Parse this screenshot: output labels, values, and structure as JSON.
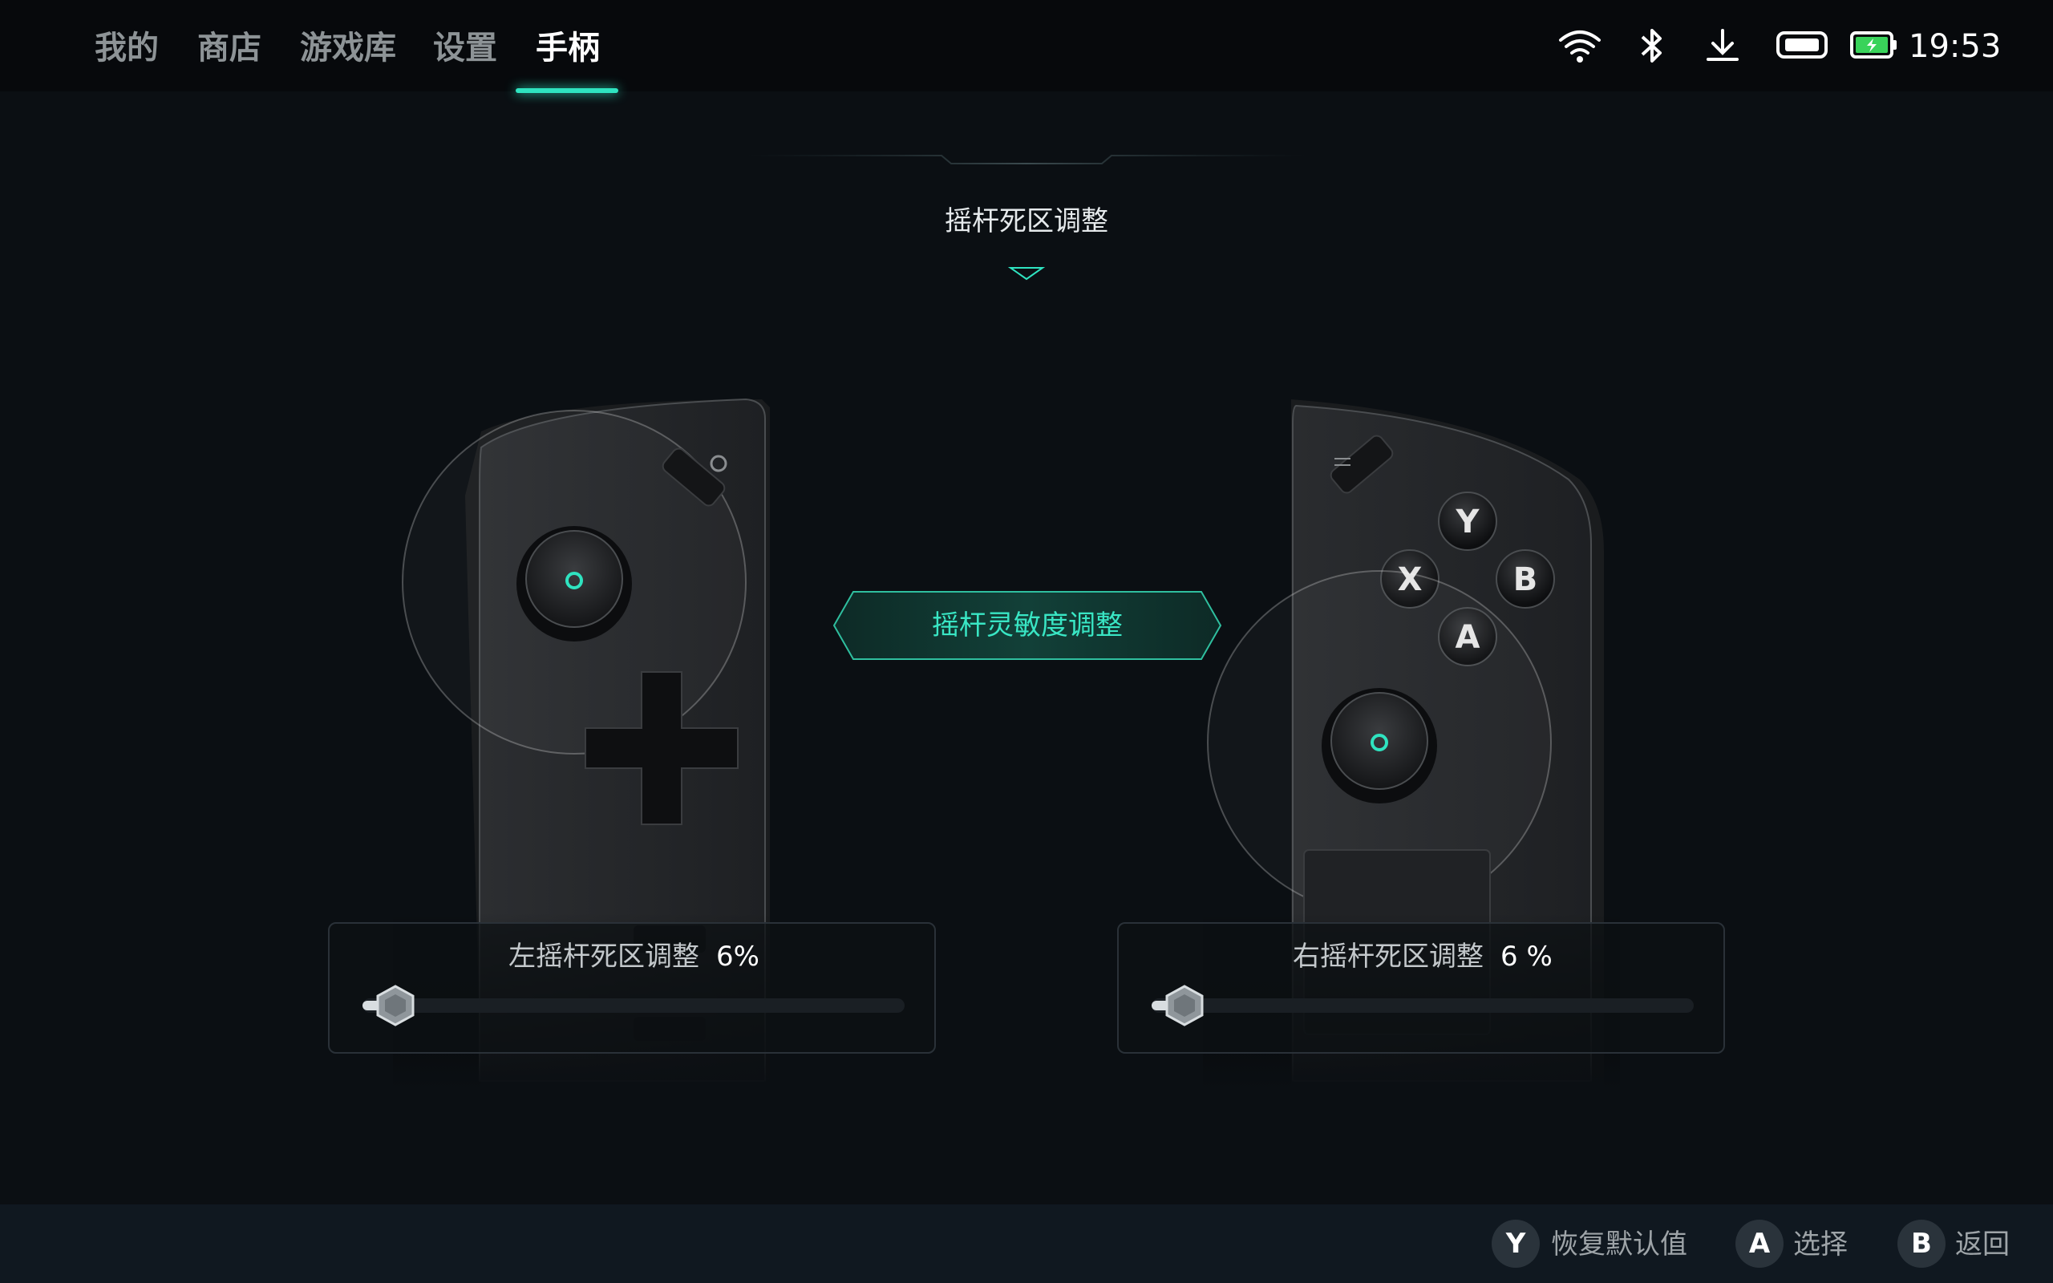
{
  "nav": {
    "tabs": [
      {
        "label": "我的"
      },
      {
        "label": "商店"
      },
      {
        "label": "游戏库"
      },
      {
        "label": "设置"
      },
      {
        "label": "手柄"
      }
    ],
    "active_tab": "手柄"
  },
  "status": {
    "icons": [
      "wifi-icon",
      "bluetooth-icon",
      "download-icon",
      "controller-battery-icon",
      "battery-charging-icon"
    ],
    "time": "19:53"
  },
  "page": {
    "title": "摇杆死区调整",
    "center_button": "摇杆灵敏度调整"
  },
  "left_stick": {
    "label": "左摇杆死区调整",
    "value_text": "6%",
    "value": 6
  },
  "right_stick": {
    "label": "右摇杆死区调整",
    "value_text": "6 %",
    "value": 6
  },
  "right_controller_buttons": [
    "Y",
    "X",
    "B",
    "A"
  ],
  "footer": {
    "hints": [
      {
        "key": "Y",
        "label": "恢复默认值"
      },
      {
        "key": "A",
        "label": "选择"
      },
      {
        "key": "B",
        "label": "返回"
      }
    ]
  },
  "colors": {
    "accent": "#2fe3c0",
    "background": "#0b0f13",
    "topbar": "#07090c",
    "footer": "#101820"
  }
}
